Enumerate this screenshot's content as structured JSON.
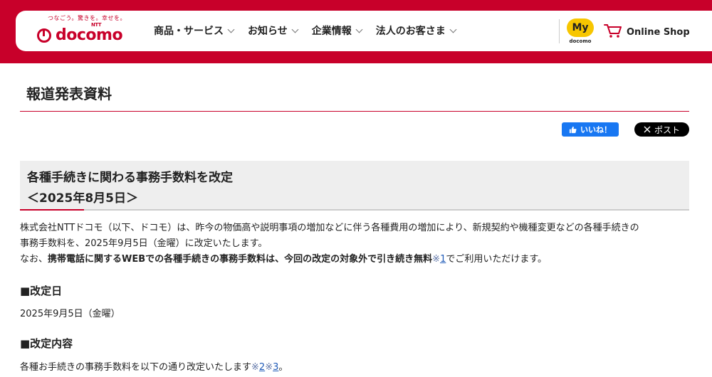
{
  "header": {
    "tagline": "つなごう。驚きを。幸せを。",
    "logo_small": "NTT",
    "logo_text": "docomo",
    "nav": [
      {
        "label": "商品・サービス"
      },
      {
        "label": "お知らせ"
      },
      {
        "label": "企業情報"
      },
      {
        "label": "法人のお客さま"
      }
    ],
    "my_label": "My",
    "my_sub": "docomo",
    "shop_label": "Online Shop"
  },
  "page": {
    "title": "報道発表資料"
  },
  "social": {
    "like_label": "いいね！",
    "post_label": "ポスト"
  },
  "article": {
    "headline": "各種手続きに関わる事務手数料を改定",
    "date": "＜2025年8月5日＞",
    "para1_line1": "株式会社NTTドコモ（以下、ドコモ）は、昨今の物価高や説明事項の増加などに伴う各種費用の増加により、新規契約や機種変更などの各種手続きの",
    "para1_line2": "事務手数料を、2025年9月5日（金曜）に改定いたします。",
    "para2_prefix": "なお、",
    "para2_bold": "携帯電話に関するWEBでの各種手続きの事務手数料は、今回の改定の対象外で引き続き無料",
    "para2_note_mark": "※",
    "para2_note_num": "1",
    "para2_suffix": "でご利用いただけます。",
    "sec1_title": "■改定日",
    "sec1_body": "2025年9月5日（金曜）",
    "sec2_title": "■改定内容",
    "sec2_body": "各種お手続きの事務手数料を以下の通り改定いたします",
    "sec2_note1_mark": "※",
    "sec2_note1_num": "2",
    "sec2_note2_mark": "※",
    "sec2_note2_num": "3",
    "sec2_end": "。"
  },
  "colors": {
    "brand": "#c8002a",
    "my_badge": "#f7c600",
    "facebook": "#1877f2"
  }
}
